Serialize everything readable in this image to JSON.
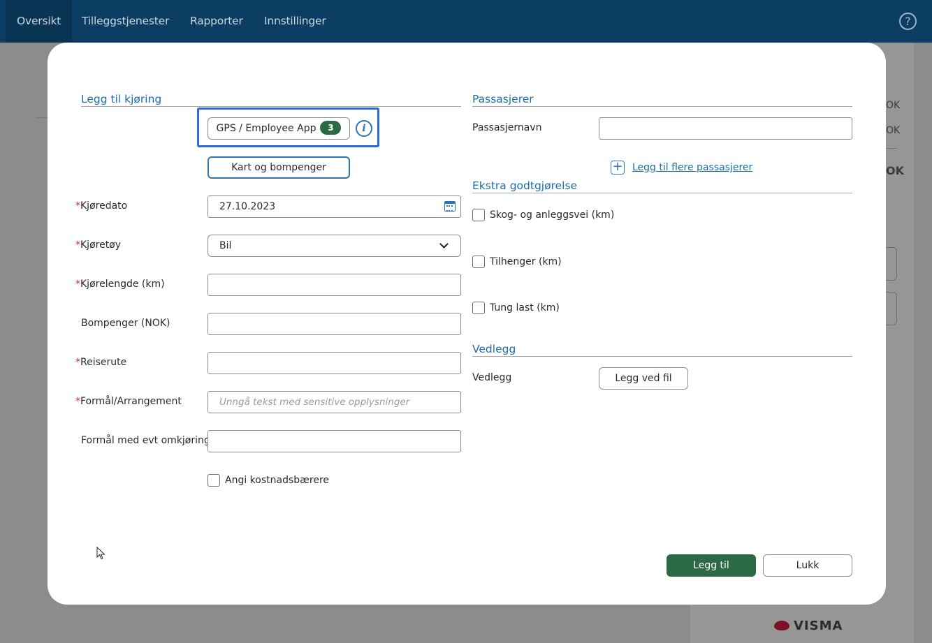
{
  "nav": {
    "items": [
      "Oversikt",
      "Tilleggstjenester",
      "Rapporter",
      "Innstillinger"
    ],
    "help_icon": "question-circle-icon"
  },
  "background": {
    "snippets": [
      "OK",
      "OK",
      "OK"
    ],
    "brand": "VISMA"
  },
  "form": {
    "title": "Legg til kjøring",
    "gps_button": {
      "label": "GPS / Employee App",
      "count": "3"
    },
    "info_icon": "i",
    "map_button": "Kart og bompenger",
    "fields": {
      "date": {
        "label": "Kjøredato",
        "value": "27.10.2023"
      },
      "vehicle": {
        "label": "Kjøretøy",
        "value": "Bil"
      },
      "distance": {
        "label": "Kjørelengde (km)",
        "value": ""
      },
      "tolls": {
        "label": "Bompenger (NOK)",
        "value": ""
      },
      "route": {
        "label": "Reiserute",
        "value": ""
      },
      "purpose": {
        "label": "Formål/Arrangement",
        "value": "",
        "placeholder": "Unngå tekst med sensitive opplysninger"
      },
      "detour": {
        "label": "Formål med evt omkjøring",
        "value": ""
      }
    },
    "required_marker": "*",
    "cost_carrier_label": "Angi kostnadsbærere"
  },
  "passengers": {
    "title": "Passasjerer",
    "name_label": "Passasjernavn",
    "name_value": "",
    "add_more_link": "Legg til flere passasjerer"
  },
  "extra": {
    "title": "Ekstra godtgjørelse",
    "options": [
      "Skog- og anleggsvei (km)",
      "Tilhenger (km)",
      "Tung last (km)"
    ]
  },
  "attachments": {
    "title": "Vedlegg",
    "label": "Vedlegg",
    "button": "Legg ved fil"
  },
  "actions": {
    "submit": "Legg til",
    "close": "Lukk"
  },
  "colors": {
    "nav_bg": "#0c3e63",
    "accent_blue": "#1b6ea8",
    "primary_green": "#2c6a45",
    "required_red": "#c0263d",
    "focus_blue": "#2a6bd4"
  }
}
